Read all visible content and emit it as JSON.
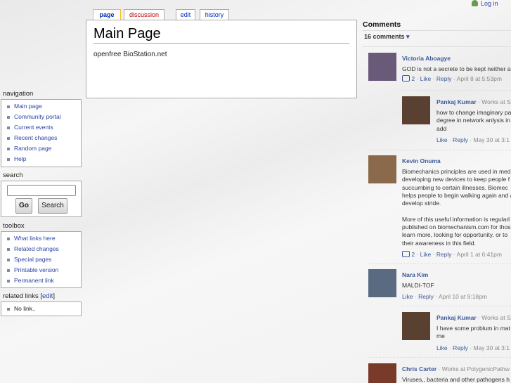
{
  "tabs": [
    "page",
    "discussion",
    "edit",
    "history"
  ],
  "personal": {
    "login": "Log in"
  },
  "content": {
    "title": "Main Page",
    "body": "openfree BioStation.net"
  },
  "navigation": {
    "heading": "navigation",
    "items": [
      "Main page",
      "Community portal",
      "Current events",
      "Recent changes",
      "Random page",
      "Help"
    ]
  },
  "search": {
    "heading": "search",
    "go": "Go",
    "search": "Search",
    "value": ""
  },
  "toolbox": {
    "heading": "toolbox",
    "items": [
      "What links here",
      "Related changes",
      "Special pages",
      "Printable version",
      "Permanent link"
    ]
  },
  "related": {
    "heading": "related links [",
    "edit": "edit",
    "close": "]",
    "items": [
      "No link.."
    ]
  },
  "comments": {
    "heading": "Comments",
    "count": "16 comments",
    "list": [
      {
        "name": "Victoria Aboagye",
        "work": "",
        "lines": [
          "GOD is not a secrete to be kept neither a"
        ],
        "likes": "2",
        "like": "Like",
        "reply": "Reply",
        "time": "April 8 at 5:53pm"
      },
      {
        "name": "Pankaj Kumar",
        "work": "· Works at S",
        "lines": [
          "how to change imaginary pa",
          "degree in network anlysis in",
          "add"
        ],
        "likes": "",
        "like": "Like",
        "reply": "Reply",
        "time": "May 30 at 3:1"
      },
      {
        "name": "Kevin Onuma",
        "work": "",
        "lines": [
          "Biomechanics principles are used in med",
          "developing new devices to keep people f",
          "succumbing to certain illnesses. Biomec",
          "helps people to begin walking again and a",
          "develop stride.",
          "",
          "More of this useful information is regularl",
          "published on biomechanism.com for thos",
          "learn more, looking for opportunity, or to",
          "their awareness in this field."
        ],
        "likes": "2",
        "like": "Like",
        "reply": "Reply",
        "time": "April 1 at 6:41pm"
      },
      {
        "name": "Nara Kim",
        "work": "",
        "lines": [
          "MALDI-TOF"
        ],
        "likes": "",
        "like": "Like",
        "reply": "Reply",
        "time": "April 10 at 9:18pm"
      },
      {
        "name": "Pankaj Kumar",
        "work": "· Works at S",
        "lines": [
          "I have some problum in mat",
          "me"
        ],
        "likes": "",
        "like": "Like",
        "reply": "Reply",
        "time": "May 30 at 3:1"
      },
      {
        "name": "Chris Carter",
        "work": "· Works at PolygenicPathw",
        "lines": [
          "Viruses,, bacteria and other pathogens h"
        ]
      }
    ]
  },
  "colors": {
    "link": "#2a45a8",
    "fbname": "#3b5998",
    "tabsel": "#fabd23",
    "discussion": "#ba0000"
  }
}
